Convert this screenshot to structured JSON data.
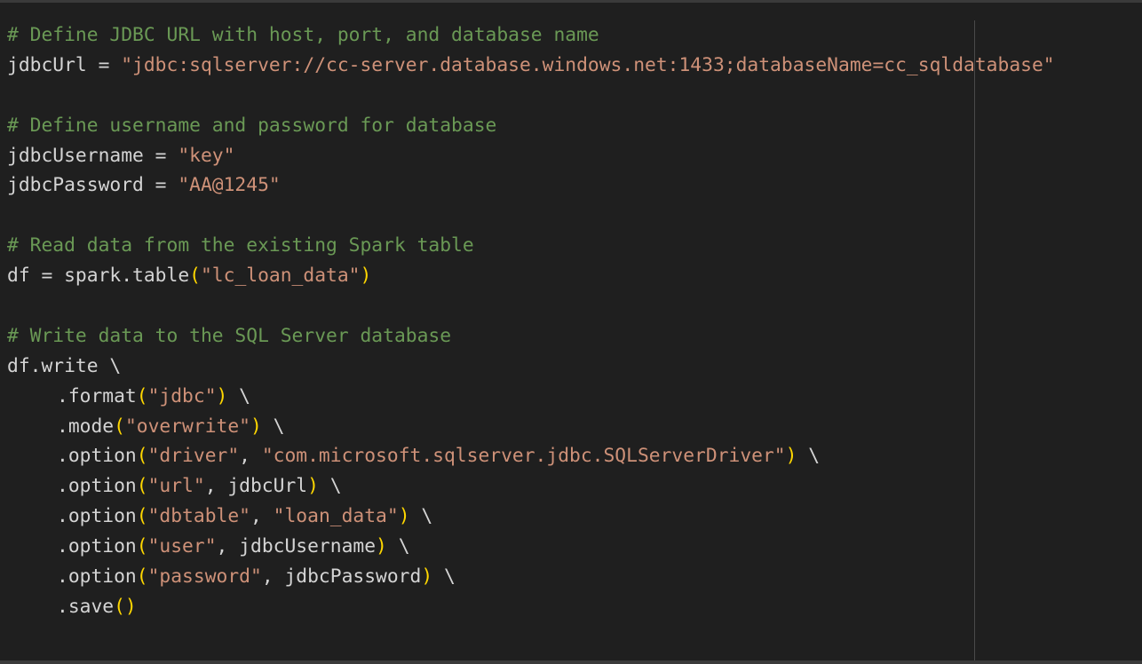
{
  "editor": {
    "language": "python",
    "colors": {
      "background": "#1f1f1f",
      "default": "#d4d4d4",
      "comment": "#6a9955",
      "string": "#ce9178",
      "paren": "#ffd700"
    },
    "lines": [
      {
        "indent": false,
        "tokens": [
          {
            "t": "comment",
            "v": "# Define JDBC URL with host, port, and database name"
          }
        ]
      },
      {
        "indent": false,
        "tokens": [
          {
            "t": "ident",
            "v": "jdbcUrl = "
          },
          {
            "t": "string",
            "v": "\"jdbc:sqlserver://cc-server.database.windows.net:1433;databaseName=cc_sqldatabase\""
          }
        ]
      },
      {
        "indent": false,
        "tokens": []
      },
      {
        "indent": false,
        "tokens": [
          {
            "t": "comment",
            "v": "# Define username and password for database"
          }
        ]
      },
      {
        "indent": false,
        "tokens": [
          {
            "t": "ident",
            "v": "jdbcUsername = "
          },
          {
            "t": "string",
            "v": "\"key\""
          }
        ]
      },
      {
        "indent": false,
        "tokens": [
          {
            "t": "ident",
            "v": "jdbcPassword = "
          },
          {
            "t": "string",
            "v": "\"AA@1245\""
          }
        ]
      },
      {
        "indent": false,
        "tokens": []
      },
      {
        "indent": false,
        "tokens": [
          {
            "t": "comment",
            "v": "# Read data from the existing Spark table"
          }
        ]
      },
      {
        "indent": false,
        "tokens": [
          {
            "t": "ident",
            "v": "df = spark.table"
          },
          {
            "t": "paren",
            "v": "("
          },
          {
            "t": "string",
            "v": "\"lc_loan_data\""
          },
          {
            "t": "paren",
            "v": ")"
          }
        ]
      },
      {
        "indent": false,
        "tokens": []
      },
      {
        "indent": false,
        "tokens": [
          {
            "t": "comment",
            "v": "# Write data to the SQL Server database"
          }
        ]
      },
      {
        "indent": false,
        "tokens": [
          {
            "t": "ident",
            "v": "df.write \\"
          }
        ]
      },
      {
        "indent": true,
        "tokens": [
          {
            "t": "ident",
            "v": ".format"
          },
          {
            "t": "paren",
            "v": "("
          },
          {
            "t": "string",
            "v": "\"jdbc\""
          },
          {
            "t": "paren",
            "v": ")"
          },
          {
            "t": "ident",
            "v": " \\"
          }
        ]
      },
      {
        "indent": true,
        "tokens": [
          {
            "t": "ident",
            "v": ".mode"
          },
          {
            "t": "paren",
            "v": "("
          },
          {
            "t": "string",
            "v": "\"overwrite\""
          },
          {
            "t": "paren",
            "v": ")"
          },
          {
            "t": "ident",
            "v": " \\"
          }
        ]
      },
      {
        "indent": true,
        "tokens": [
          {
            "t": "ident",
            "v": ".option"
          },
          {
            "t": "paren",
            "v": "("
          },
          {
            "t": "string",
            "v": "\"driver\""
          },
          {
            "t": "ident",
            "v": ", "
          },
          {
            "t": "string",
            "v": "\"com.microsoft.sqlserver.jdbc.SQLServerDriver\""
          },
          {
            "t": "paren",
            "v": ")"
          },
          {
            "t": "ident",
            "v": " \\"
          }
        ]
      },
      {
        "indent": true,
        "tokens": [
          {
            "t": "ident",
            "v": ".option"
          },
          {
            "t": "paren",
            "v": "("
          },
          {
            "t": "string",
            "v": "\"url\""
          },
          {
            "t": "ident",
            "v": ", jdbcUrl"
          },
          {
            "t": "paren",
            "v": ")"
          },
          {
            "t": "ident",
            "v": " \\"
          }
        ]
      },
      {
        "indent": true,
        "tokens": [
          {
            "t": "ident",
            "v": ".option"
          },
          {
            "t": "paren",
            "v": "("
          },
          {
            "t": "string",
            "v": "\"dbtable\""
          },
          {
            "t": "ident",
            "v": ", "
          },
          {
            "t": "string",
            "v": "\"loan_data\""
          },
          {
            "t": "paren",
            "v": ")"
          },
          {
            "t": "ident",
            "v": " \\"
          }
        ]
      },
      {
        "indent": true,
        "tokens": [
          {
            "t": "ident",
            "v": ".option"
          },
          {
            "t": "paren",
            "v": "("
          },
          {
            "t": "string",
            "v": "\"user\""
          },
          {
            "t": "ident",
            "v": ", jdbcUsername"
          },
          {
            "t": "paren",
            "v": ")"
          },
          {
            "t": "ident",
            "v": " \\"
          }
        ]
      },
      {
        "indent": true,
        "tokens": [
          {
            "t": "ident",
            "v": ".option"
          },
          {
            "t": "paren",
            "v": "("
          },
          {
            "t": "string",
            "v": "\"password\""
          },
          {
            "t": "ident",
            "v": ", jdbcPassword"
          },
          {
            "t": "paren",
            "v": ")"
          },
          {
            "t": "ident",
            "v": " \\"
          }
        ]
      },
      {
        "indent": true,
        "tokens": [
          {
            "t": "ident",
            "v": ".save"
          },
          {
            "t": "paren",
            "v": "()"
          }
        ]
      }
    ]
  }
}
